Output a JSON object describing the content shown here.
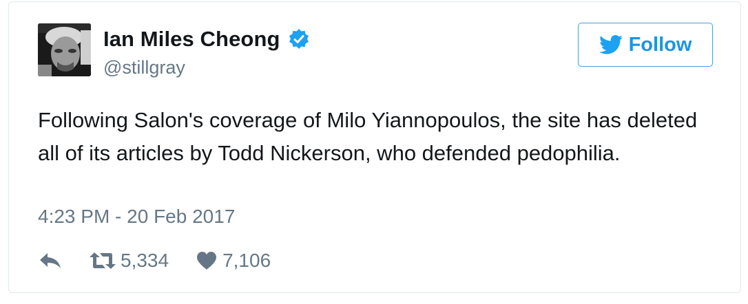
{
  "tweet": {
    "display_name": "Ian Miles Cheong",
    "handle": "@stillgray",
    "follow_label": "Follow",
    "text": "Following Salon's coverage of Milo Yiannopoulos, the site has deleted all of its articles by Todd Nickerson, who defended pedophilia.",
    "timestamp": "4:23 PM - 20 Feb 2017",
    "retweets": "5,334",
    "likes": "7,106"
  },
  "icons": {
    "verified": "verified-badge-icon",
    "follow": "twitter-bird-icon",
    "reply": "reply-icon",
    "retweet": "retweet-icon",
    "like": "heart-icon"
  },
  "colors": {
    "accent": "#1da1f2",
    "text": "#14171a",
    "muted": "#657786",
    "border": "#e1e8ed"
  }
}
